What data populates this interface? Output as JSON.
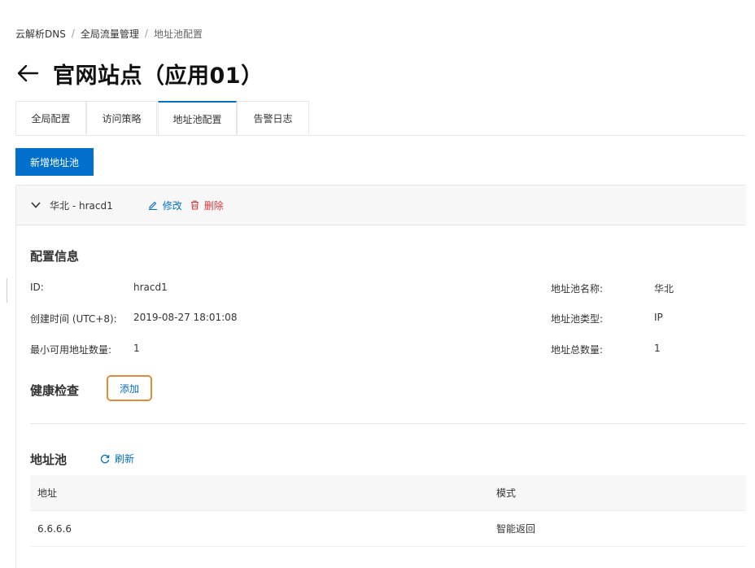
{
  "breadcrumb": {
    "items": [
      "云解析DNS",
      "全局流量管理",
      "地址池配置"
    ],
    "separator": "/"
  },
  "header": {
    "back_icon": "arrow-left-icon",
    "title": "官网站点（应用01）"
  },
  "tabs": [
    {
      "label": "全局配置",
      "active": false
    },
    {
      "label": "访问策略",
      "active": false
    },
    {
      "label": "地址池配置",
      "active": true
    },
    {
      "label": "告警日志",
      "active": false
    }
  ],
  "toolbar": {
    "add_pool_label": "新增地址池"
  },
  "pool": {
    "name": "华北 - hracd1",
    "edit_label": "修改",
    "delete_label": "删除",
    "config": {
      "title": "配置信息",
      "fields": [
        {
          "label": "ID:",
          "value": "hracd1"
        },
        {
          "label": "创建时间 (UTC+8):",
          "value": "2019-08-27 18:01:08"
        },
        {
          "label": "最小可用地址数量:",
          "value": "1"
        },
        {
          "label": "地址池名称:",
          "value": "华北"
        },
        {
          "label": "地址池类型:",
          "value": "IP"
        },
        {
          "label": "地址总数量:",
          "value": "1"
        }
      ]
    },
    "health_check": {
      "title": "健康检查",
      "add_label": "添加"
    },
    "address_pool": {
      "title": "地址池",
      "refresh_label": "刷新",
      "columns": [
        "地址",
        "模式"
      ],
      "rows": [
        {
          "address": "6.6.6.6",
          "mode": "智能返回"
        }
      ]
    }
  },
  "colors": {
    "primary": "#0070cc",
    "danger": "#e0393e",
    "highlight": "#e38b3a",
    "header_bg": "#f7f7f7",
    "border": "#e6e6e6"
  }
}
